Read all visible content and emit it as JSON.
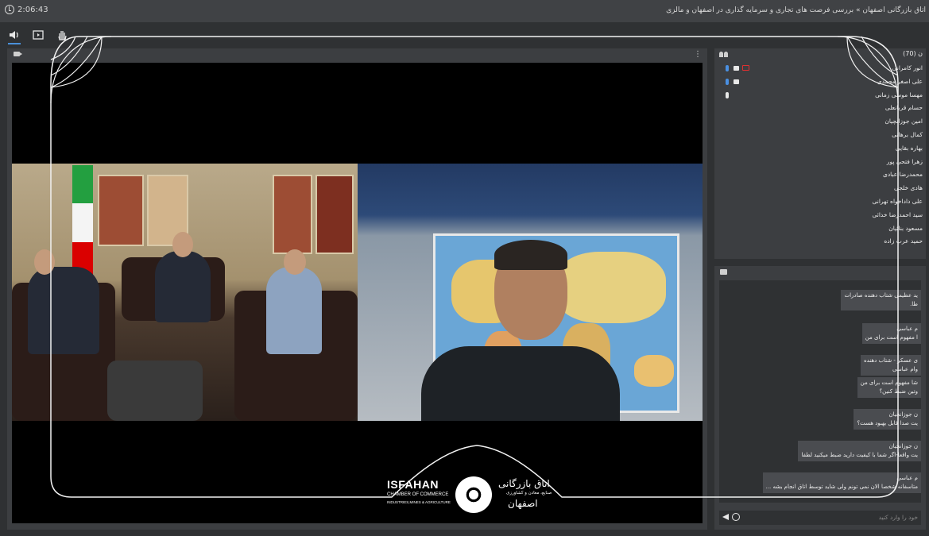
{
  "topbar": {
    "timer": "2:06:43",
    "title": "اتاق بازرگانی اصفهان » بررسی فرصت های تجاری و سرمایه گذاری در اصفهان و مالزی"
  },
  "toolbar": {
    "items": [
      "speaker-icon",
      "present-icon",
      "raise-hand-icon"
    ]
  },
  "people": {
    "count_label": "ن (70)",
    "participants": [
      {
        "name": "انور کامرانی",
        "mic": "blue",
        "video": true,
        "share": true
      },
      {
        "name": "علی اصغر محمدی",
        "mic": "blue",
        "video": true,
        "share": false
      },
      {
        "name": "مهسا موسی زمانی",
        "mic": "white",
        "video": false,
        "share": false
      },
      {
        "name": "حسام قربانعلی"
      },
      {
        "name": "امین جوزانچیان"
      },
      {
        "name": "کمال برهانی"
      },
      {
        "name": "بهاره بقایی"
      },
      {
        "name": "زهرا فتحی پور"
      },
      {
        "name": "محمدرضا عبادی"
      },
      {
        "name": "هادی خلجی"
      },
      {
        "name": "علی داداخواه تهرانی"
      },
      {
        "name": "سید احمدرضا خدائی"
      },
      {
        "name": "مسعود بنائیان"
      },
      {
        "name": "حمید عرب زاده"
      }
    ]
  },
  "chat": {
    "messages": [
      {
        "who": "ید عظیمی شتاب دهنده صادرات",
        "text": "طا."
      },
      {
        "who": "م عباسی",
        "text": "ا مفهوم است برای من"
      },
      {
        "who": "ی عسکر - شتاب دهنده",
        "text": "وام عباسی"
      },
      {
        "who": "شا مفهوم است برای من",
        "text": "وتین ضبط کنین؟"
      },
      {
        "who": "ن جوزانچیان",
        "text": "یت صدا قابل بهبود هست؟"
      },
      {
        "who": "ن جوزانچیان",
        "text": "یت واقعا-اگر شما با کیفیت دارید ضبط میکنید لطفا"
      },
      {
        "who": "م عباسی",
        "text": "متاسفانه شخصا الان نمی تونم ولی شاید توسط اتاق انجام بشه ..."
      }
    ],
    "input_placeholder": "خود را وارد کنید"
  },
  "logo": {
    "en_name": "ISFAHAN",
    "en_sub": "CHAMBER OF COMMERCE",
    "en_sub2": "INDUSTRIES,MINES & AGRICULTURE",
    "fa_name": "اتاق بازرگانی",
    "fa_sub": "صنایع، معادن و کشاورزی",
    "fa_city": "اصفهان"
  },
  "colors": {
    "accent": "#4a90d9",
    "mic_active": "#4a90e2",
    "share": "#e03030"
  }
}
